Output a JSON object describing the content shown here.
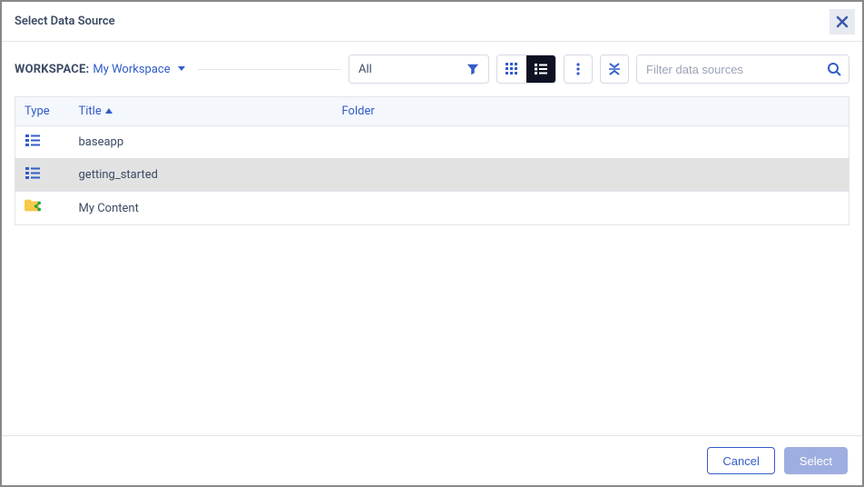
{
  "header": {
    "title": "Select Data Source"
  },
  "workspace": {
    "label": "WORKSPACE:",
    "value": "My Workspace"
  },
  "filter": {
    "selected": "All"
  },
  "search": {
    "placeholder": "Filter data sources"
  },
  "columns": {
    "type": "Type",
    "title": "Title",
    "folder": "Folder"
  },
  "rows": [
    {
      "icon": "app",
      "title": "baseapp",
      "folder": "",
      "selected": false
    },
    {
      "icon": "app",
      "title": "getting_started",
      "folder": "",
      "selected": true
    },
    {
      "icon": "shared-folder",
      "title": "My Content",
      "folder": "",
      "selected": false
    }
  ],
  "footer": {
    "cancel": "Cancel",
    "select": "Select"
  },
  "icons": {
    "grid": "grid-icon",
    "list": "list-icon",
    "more": "more-vertical-icon",
    "collapse": "collapse-icon",
    "filter": "filter-icon",
    "search": "search-icon",
    "close": "close-icon"
  }
}
